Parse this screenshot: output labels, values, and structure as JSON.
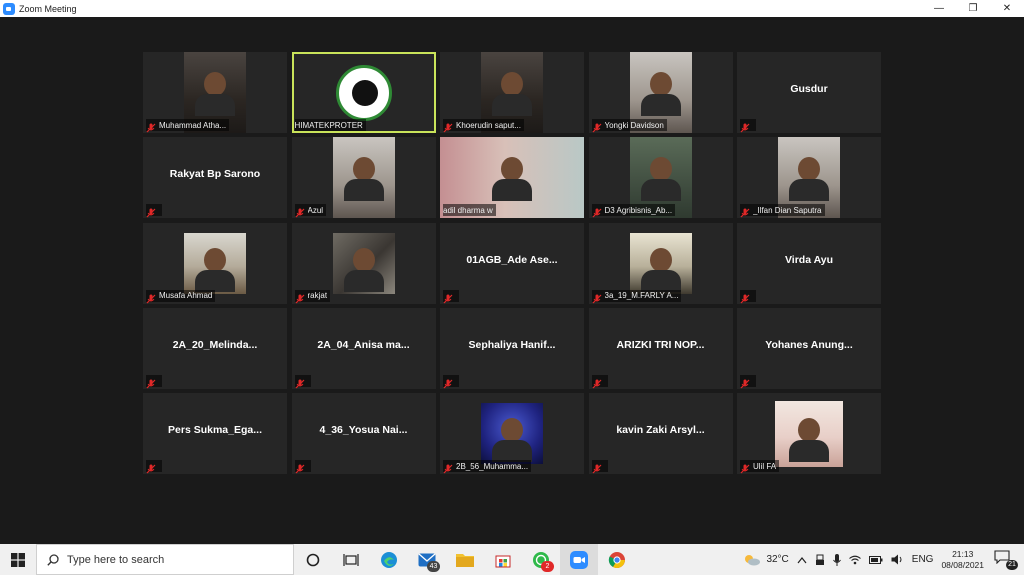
{
  "window": {
    "title": "Zoom Meeting",
    "minimize": "—",
    "restore": "❐",
    "close": "✕"
  },
  "participants": [
    {
      "display": "video",
      "name": "Muhammad Atha...",
      "muted": true,
      "photo": "dark"
    },
    {
      "display": "logo",
      "name": "HIMATEKPROTER",
      "muted": false,
      "active_speaker": true
    },
    {
      "display": "video",
      "name": "Khoerudin saput...",
      "muted": true,
      "photo": "dark"
    },
    {
      "display": "video",
      "name": "Yongki Davidson",
      "muted": true,
      "photo": "light"
    },
    {
      "display": "name",
      "name": "Gusdur",
      "muted": true
    },
    {
      "display": "name",
      "name": "Rakyat Bp Sarono",
      "muted": true
    },
    {
      "display": "video",
      "name": "Azul",
      "muted": true,
      "photo": "light"
    },
    {
      "display": "video",
      "name": "adil dharma w",
      "muted": false,
      "photo": "room"
    },
    {
      "display": "video",
      "name": "D3 Agribisnis_Ab...",
      "muted": true,
      "photo": "green"
    },
    {
      "display": "video",
      "name": "_Ilfan Dian Saputra",
      "muted": true,
      "photo": "light"
    },
    {
      "display": "video",
      "name": "Musafa Ahmad",
      "muted": true,
      "photo": "field"
    },
    {
      "display": "video",
      "name": "rakjat",
      "muted": true,
      "photo": "cat"
    },
    {
      "display": "name",
      "name": "01AGB_Ade Ase...",
      "muted": true
    },
    {
      "display": "video",
      "name": "3a_19_M.FARLY A...",
      "muted": true,
      "photo": "poster"
    },
    {
      "display": "name",
      "name": "Virda Ayu",
      "muted": true
    },
    {
      "display": "name",
      "name": "2A_20_Melinda...",
      "muted": true
    },
    {
      "display": "name",
      "name": "2A_04_Anisa ma...",
      "muted": true
    },
    {
      "display": "name",
      "name": "Sephaliya Hanif...",
      "muted": true
    },
    {
      "display": "name",
      "name": "ARIZKI TRI NOP...",
      "muted": true
    },
    {
      "display": "name",
      "name": "Yohanes Anung...",
      "muted": true
    },
    {
      "display": "name",
      "name": "Pers Sukma_Ega...",
      "muted": true
    },
    {
      "display": "name",
      "name": "4_36_Yosua Nai...",
      "muted": true
    },
    {
      "display": "video",
      "name": "2B_56_Muhamma...",
      "muted": true,
      "photo": "blue"
    },
    {
      "display": "name",
      "name": "kavin Zaki Arsyl...",
      "muted": true
    },
    {
      "display": "video",
      "name": "Ulil FA",
      "muted": true,
      "photo": "pink"
    }
  ],
  "colors": {
    "active_speaker_border": "#c9e35a",
    "muted_icon": "#e02828",
    "background": "#1a1a1a",
    "tile": "#262626"
  },
  "taskbar": {
    "search_placeholder": "Type here to search",
    "mail_badge": "43",
    "chat_badge": "2",
    "weather": "32°C",
    "language": "ENG",
    "time": "21:13",
    "date": "08/08/2021",
    "notification_count": "21"
  }
}
